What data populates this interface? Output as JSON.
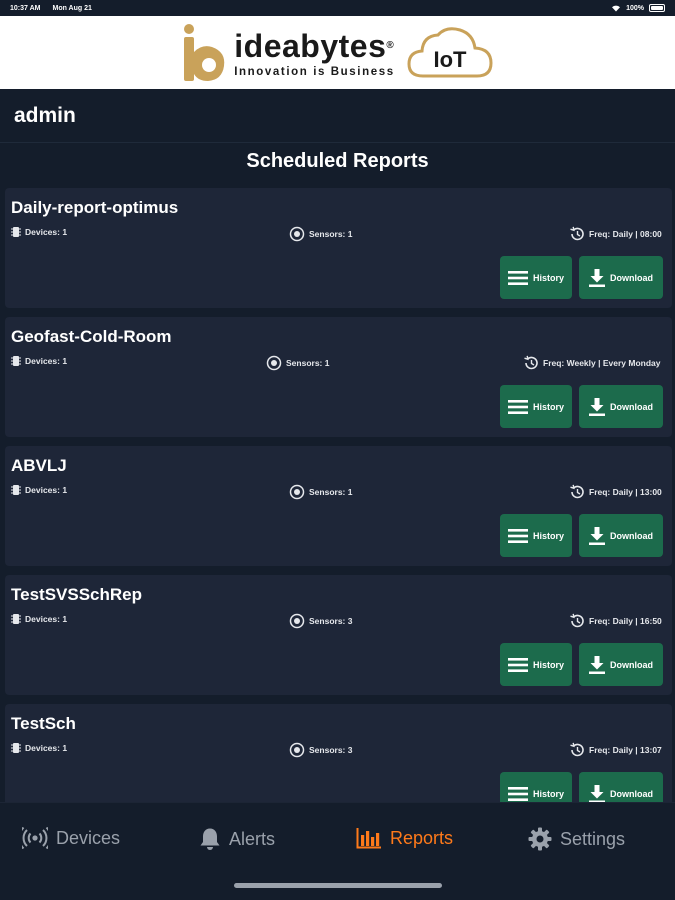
{
  "status_bar": {
    "time": "10:37 AM",
    "date": "Mon Aug 21",
    "battery": "100%"
  },
  "logo": {
    "brand": "ideabytes",
    "registered": "®",
    "tagline": "Innovation is Business",
    "badge": "IoT"
  },
  "user": {
    "name": "admin"
  },
  "page": {
    "title": "Scheduled Reports"
  },
  "reports": [
    {
      "name": "Daily-report-optimus",
      "devices": "Devices: 1",
      "sensors": "Sensors: 1",
      "freq": "Freq: Daily | 08:00",
      "history_label": "History",
      "download_label": "Download"
    },
    {
      "name": "Geofast-Cold-Room",
      "devices": "Devices: 1",
      "sensors": "Sensors: 1",
      "freq": "Freq: Weekly | Every Monday",
      "history_label": "History",
      "download_label": "Download"
    },
    {
      "name": "ABVLJ",
      "devices": "Devices: 1",
      "sensors": "Sensors: 1",
      "freq": "Freq: Daily | 13:00",
      "history_label": "History",
      "download_label": "Download"
    },
    {
      "name": "TestSVSSchRep",
      "devices": "Devices: 1",
      "sensors": "Sensors: 3",
      "freq": "Freq: Daily | 16:50",
      "history_label": "History",
      "download_label": "Download"
    },
    {
      "name": "TestSch",
      "devices": "Devices: 1",
      "sensors": "Sensors: 3",
      "freq": "Freq: Daily | 13:07",
      "history_label": "History",
      "download_label": "Download"
    }
  ],
  "nav": {
    "devices": "Devices",
    "alerts": "Alerts",
    "reports": "Reports",
    "settings": "Settings",
    "active": "reports",
    "active_color": "#ff7a1a",
    "inactive_color": "#9aa1ab"
  },
  "colors": {
    "background": "#141d2b",
    "card": "#1e2638",
    "button": "#1c6b4c",
    "logo_gold": "#c9a25a"
  }
}
